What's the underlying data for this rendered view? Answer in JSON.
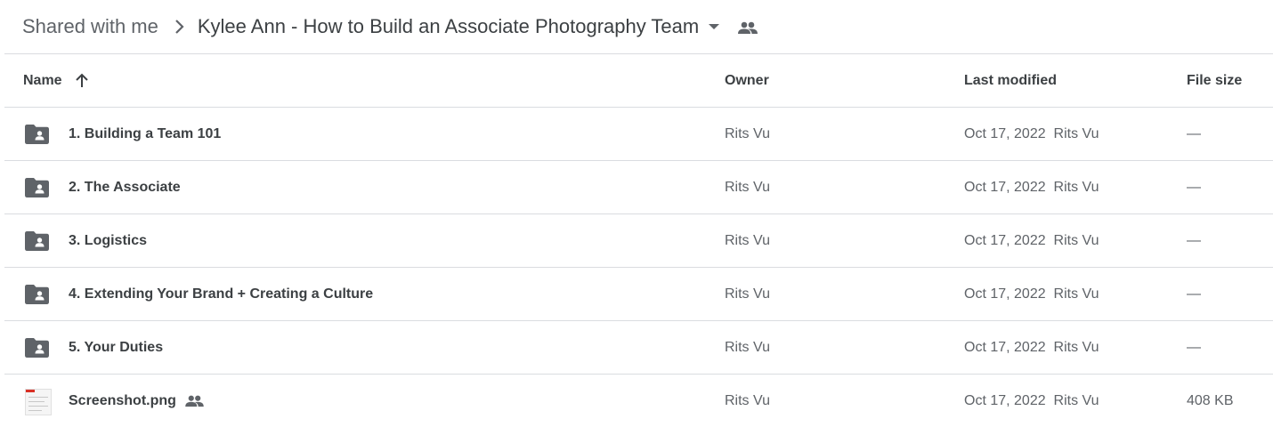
{
  "breadcrumb": {
    "root": "Shared with me",
    "current": "Kylee Ann - How to Build an Associate Photography Team"
  },
  "columns": {
    "name": "Name",
    "owner": "Owner",
    "last_modified": "Last modified",
    "file_size": "File size"
  },
  "rows": [
    {
      "name": "1. Building a Team 101",
      "type": "shared-folder",
      "owner": "Rits Vu",
      "modified_date": "Oct 17, 2022",
      "modified_by": "Rits Vu",
      "size": "—"
    },
    {
      "name": "2. The Associate",
      "type": "shared-folder",
      "owner": "Rits Vu",
      "modified_date": "Oct 17, 2022",
      "modified_by": "Rits Vu",
      "size": "—"
    },
    {
      "name": "3. Logistics",
      "type": "shared-folder",
      "owner": "Rits Vu",
      "modified_date": "Oct 17, 2022",
      "modified_by": "Rits Vu",
      "size": "—"
    },
    {
      "name": "4. Extending Your Brand + Creating a Culture",
      "type": "shared-folder",
      "owner": "Rits Vu",
      "modified_date": "Oct 17, 2022",
      "modified_by": "Rits Vu",
      "size": "—"
    },
    {
      "name": "5. Your Duties",
      "type": "shared-folder",
      "owner": "Rits Vu",
      "modified_date": "Oct 17, 2022",
      "modified_by": "Rits Vu",
      "size": "—"
    },
    {
      "name": "Screenshot.png",
      "type": "image-file",
      "owner": "Rits Vu",
      "modified_date": "Oct 17, 2022",
      "modified_by": "Rits Vu",
      "size": "408 KB"
    }
  ],
  "icons": {
    "breadcrumb_separator": "chevron-right-icon",
    "folder_menu": "caret-down-icon",
    "shared": "people-icon",
    "sort": "arrow-up-icon",
    "folder": "shared-folder-icon",
    "file": "image-thumbnail"
  },
  "colors": {
    "text_primary": "#3c4043",
    "text_secondary": "#5f6368",
    "divider": "#dadce0",
    "icon": "#5f6368"
  }
}
